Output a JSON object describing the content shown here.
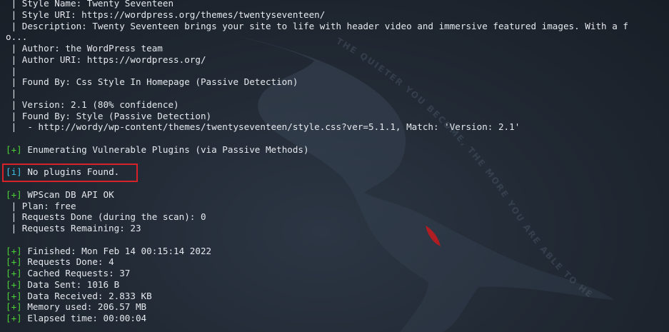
{
  "theme": {
    "style_name": " | Style Name: Twenty Seventeen",
    "style_uri": " | Style URI: https://wordpress.org/themes/twentyseventeen/",
    "description_1": " | Description: Twenty Seventeen brings your site to life with header video and immersive featured images. With a f",
    "description_2": "o...",
    "author": " | Author: the WordPress team",
    "author_uri": " | Author URI: https://wordpress.org/",
    "bar": " |",
    "found_by_css": " | Found By: Css Style In Homepage (Passive Detection)",
    "version": " | Version: 2.1 (80% confidence)",
    "found_by_style": " | Found By: Style (Passive Detection)",
    "style_match": " |  - http://wordy/wp-content/themes/twentyseventeen/style.css?ver=5.1.1, Match: 'Version: 2.1'"
  },
  "plugins": {
    "enumerating_tag": "[+]",
    "enumerating_text": " Enumerating Vulnerable Plugins (via Passive Methods)",
    "none_tag": "[i]",
    "none_text": " No plugins Found."
  },
  "api": {
    "tag": "[+]",
    "status": " WPScan DB API OK",
    "plan": " | Plan: free",
    "requests_done_scan": " | Requests Done (during the scan): 0",
    "requests_remaining": " | Requests Remaining: 23"
  },
  "summary": {
    "tag": "[+]",
    "finished": " Finished: Mon Feb 14 00:15:14 2022",
    "requests_done": " Requests Done: 4",
    "cached_requests": " Cached Requests: 37",
    "data_sent": " Data Sent: 1016 B",
    "data_received": " Data Received: 2.833 KB",
    "memory_used": " Memory used: 206.57 MB",
    "elapsed_time": " Elapsed time: 00:00:04"
  },
  "background": {
    "watermark_text": "THE QUIETER YOU BECOME, THE MORE YOU ARE ABLE TO HEAR"
  },
  "colors": {
    "background": "#1f2630",
    "text": "#e6e9ee",
    "plus_tag": "#4cd137",
    "info_tag": "#3ec1e6",
    "highlight_border": "#d8222a"
  }
}
